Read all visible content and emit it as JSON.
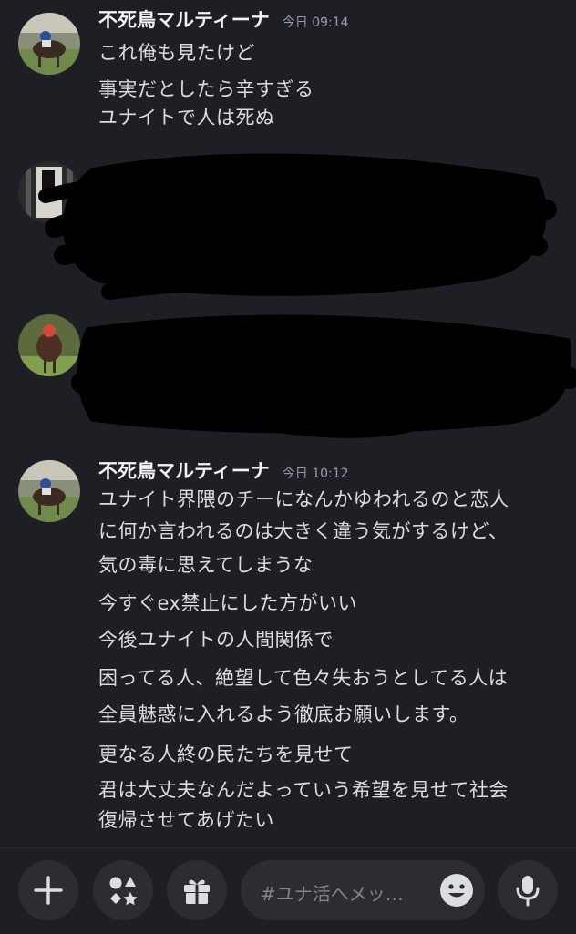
{
  "messages": [
    {
      "author": "不死鳥マルティーナ",
      "time": "今日 09:14",
      "lines": [
        "これ俺も見たけど",
        "事実だとしたら辛すぎる",
        "ユナイトで人は死ぬ"
      ]
    },
    {
      "author": "",
      "time": "",
      "lines": [
        "",
        "",
        ""
      ]
    },
    {
      "author": "",
      "time": "",
      "lines": [
        "",
        "",
        ""
      ]
    },
    {
      "author": "不死鳥マルティーナ",
      "time": "今日 10:12",
      "lines": [
        "ユナイト界隈のチーになんかゆわれるのと恋人",
        "に何か言われるのは大きく違う気がするけど、",
        "気の毒に思えてしまうな",
        "今すぐex禁止にした方がいい",
        "今後ユナイトの人間関係で",
        "困ってる人、絶望して色々失おうとしてる人は",
        "全員魅惑に入れるよう徹底お願いします。",
        "更なる人終の民たちを見せて",
        "君は大丈夫なんだよっていう希望を見せて社会",
        "復帰させてあげたい"
      ]
    }
  ],
  "composer": {
    "placeholder": "#ユナ活へメッ…",
    "add_icon": "plus-icon",
    "apps_icon": "apps-icon",
    "gift_icon": "gift-icon",
    "emoji_icon": "emoji-icon",
    "mic_icon": "mic-icon"
  },
  "colors": {
    "background": "#1e1f25",
    "input_background": "#2b2d31",
    "text": "#dbdee1",
    "timestamp": "#949ba4"
  }
}
